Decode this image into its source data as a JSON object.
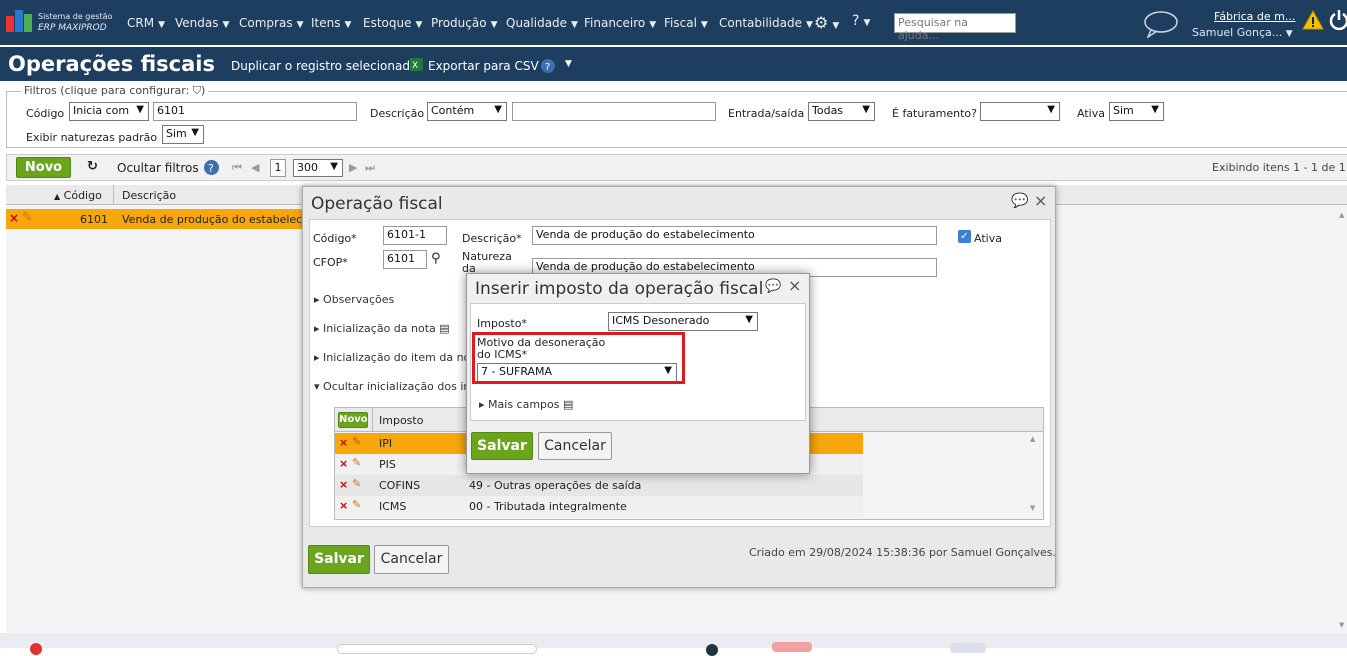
{
  "app": {
    "brand_line1": "Sistema de gestão",
    "brand_line2": "ERP MAXIPROD",
    "menu": [
      "CRM",
      "Vendas",
      "Compras",
      "Itens",
      "Estoque",
      "Produção",
      "Qualidade",
      "Financeiro",
      "Fiscal",
      "Contabilidade"
    ],
    "help_search_placeholder": "Pesquisar na ajuda...",
    "company": "Fábrica de m...",
    "user": "Samuel Gonça..."
  },
  "page": {
    "title": "Operações fiscais",
    "duplicate_link": "Duplicar o registro selecionado",
    "export_link": "Exportar para CSV"
  },
  "filters": {
    "legend": "Filtros (clique para configurar:",
    "codigo_label": "Código",
    "codigo_mode": "Inicia com",
    "codigo_value": "6101",
    "descricao_label": "Descrição",
    "descricao_mode": "Contém",
    "descricao_value": "",
    "entrada_label": "Entrada/saída",
    "entrada_value": "Todas",
    "faturamento_label": "É faturamento?",
    "faturamento_value": "",
    "ativa_label": "Ativa",
    "ativa_value": "Sim",
    "naturezas_label": "Exibir naturezas padrão",
    "naturezas_value": "Sim"
  },
  "toolbar": {
    "new_label": "Novo",
    "hide_filters": "Ocultar filtros",
    "page": "1",
    "page_size": "300",
    "showing": "Exibindo itens 1 - 1 de 1"
  },
  "grid": {
    "col_codigo": "Código",
    "col_descricao": "Descrição",
    "row": {
      "codigo": "6101",
      "descricao": "Venda de produção do estabelecim"
    }
  },
  "dialog_operacao": {
    "title": "Operação fiscal",
    "codigo_label": "Código*",
    "codigo_value": "6101-1",
    "cfop_label": "CFOP*",
    "cfop_value": "6101",
    "descricao_label": "Descrição*",
    "descricao_value": "Venda de produção do estabelecimento",
    "natureza_label_1": "Natureza",
    "natureza_label_2": "da",
    "natureza_value": "Venda de produção do estabelecimento",
    "ativa_label": "Ativa",
    "sections": [
      "Observações",
      "Inicialização da nota",
      "Inicialização do item da nc",
      "Ocultar inicialização dos in"
    ],
    "subgrid_new": "Novo",
    "subgrid_col_imposto": "Imposto",
    "subgrid_rows": [
      {
        "imposto": "IPI",
        "valor": ""
      },
      {
        "imposto": "PIS",
        "valor": ""
      },
      {
        "imposto": "COFINS",
        "valor": "49 - Outras operações de saída"
      },
      {
        "imposto": "ICMS",
        "valor": "00 - Tributada integralmente"
      }
    ],
    "save_label": "Salvar",
    "cancel_label": "Cancelar",
    "created_info": "Criado em 29/08/2024 15:38:36 por Samuel Gonçalves."
  },
  "dialog_imposto": {
    "title": "Inserir imposto da operação fiscal",
    "imposto_label": "Imposto*",
    "imposto_value": "ICMS Desonerado",
    "motivo_label_1": "Motivo da desoneração",
    "motivo_label_2": "do ICMS*",
    "motivo_value": "7 - SUFRAMA",
    "mais_campos": "Mais campos",
    "save_label": "Salvar",
    "cancel_label": "Cancelar"
  },
  "colors": {
    "header_bg": "#1d3e5f",
    "green": "#6aa51c",
    "selected_row": "#f7a60c",
    "highlight": "#e0191c"
  }
}
